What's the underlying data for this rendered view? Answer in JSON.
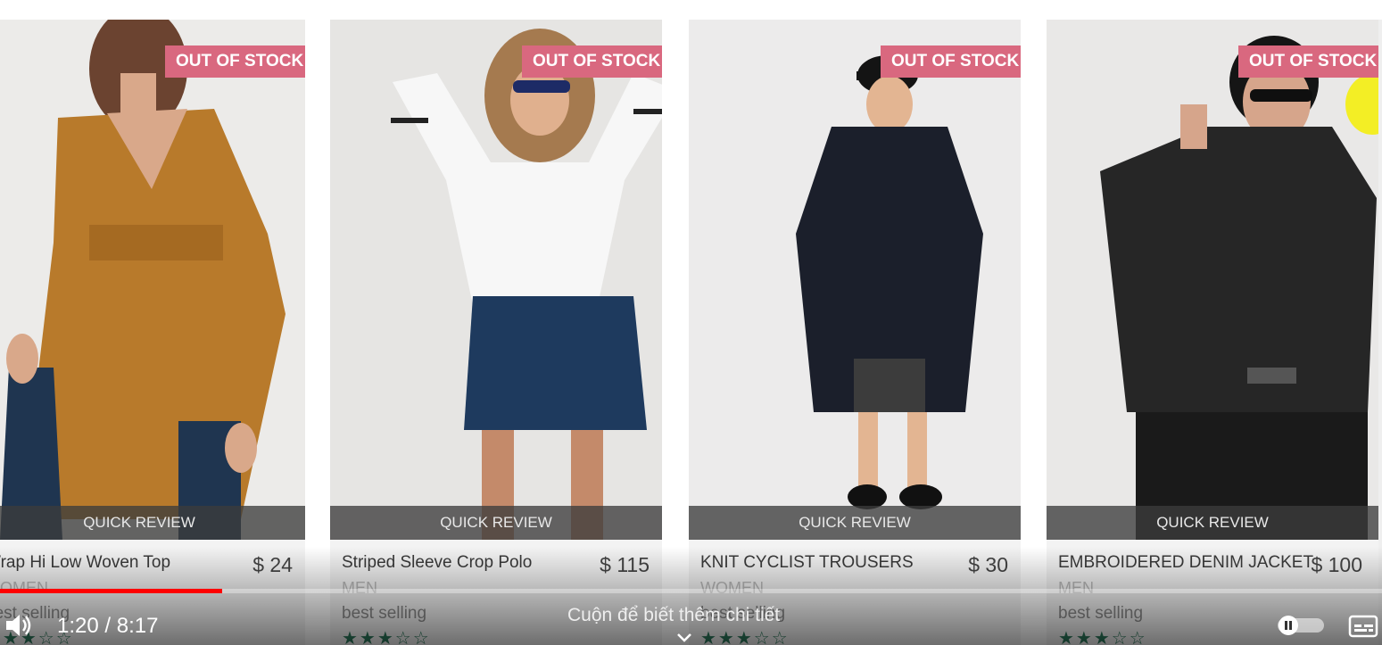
{
  "products": [
    {
      "badge": "OUT OF STOCK",
      "quick_review": "QUICK REVIEW",
      "name": "Wrap Hi Low Woven Top",
      "price": "$ 24",
      "category": "WOMEN",
      "tag": "best selling",
      "stars": "★★★☆☆"
    },
    {
      "badge": "OUT OF STOCK",
      "quick_review": "QUICK REVIEW",
      "name": "Striped Sleeve Crop Polo",
      "price": "$ 115",
      "category": "MEN",
      "tag": "best selling",
      "stars": "★★★☆☆"
    },
    {
      "badge": "OUT OF STOCK",
      "quick_review": "QUICK REVIEW",
      "name": "KNIT CYCLIST TROUSERS",
      "price": "$ 30",
      "category": "WOMEN",
      "tag": "best selling",
      "stars": "★★★☆☆"
    },
    {
      "badge": "OUT OF STOCK",
      "quick_review": "QUICK REVIEW",
      "name": "EMBROIDERED DENIM JACKET",
      "price": "$ 100",
      "category": "MEN",
      "tag": "best selling",
      "stars": "★★★☆☆"
    }
  ],
  "player": {
    "time": "1:20 / 8:17",
    "progress_fraction": 0.161,
    "scroll_hint": "Cuộn để biết thêm chi tiết",
    "volume_icon": "volume-icon",
    "autoplay_icon": "autoplay-toggle-icon",
    "subtitles_icon": "subtitles-icon",
    "accent_color": "#ff0000"
  },
  "colors": {
    "badge": "#d9687f",
    "stars": "#2d7a5d"
  }
}
